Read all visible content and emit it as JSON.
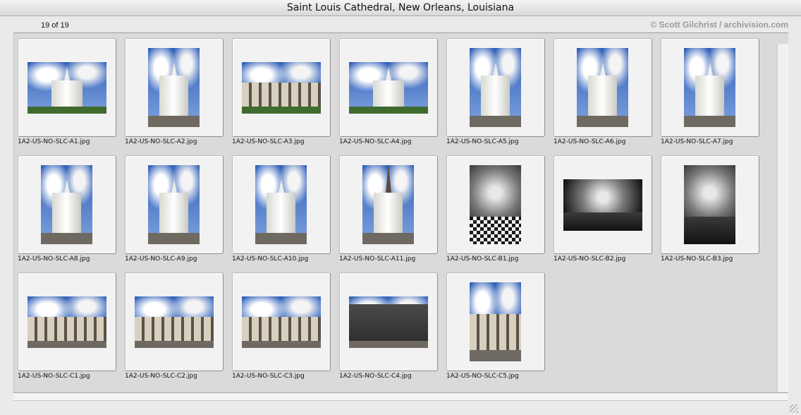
{
  "window": {
    "title": "Saint Louis Cathedral, New Orleans, Louisiana"
  },
  "toolbar": {
    "counter": "19 of 19",
    "credit": "© Scott Gilchrist / archivision.com"
  },
  "thumbnails": [
    {
      "filename": "1A2-US-NO-SLC-A1.jpg",
      "orientation": "landscape",
      "scene": "cathedral-blue-sky"
    },
    {
      "filename": "1A2-US-NO-SLC-A2.jpg",
      "orientation": "portrait",
      "scene": "cathedral-gate-lamps"
    },
    {
      "filename": "1A2-US-NO-SLC-A3.jpg",
      "orientation": "landscape",
      "scene": "jackson-square-statue"
    },
    {
      "filename": "1A2-US-NO-SLC-A4.jpg",
      "orientation": "landscape",
      "scene": "cathedral-square"
    },
    {
      "filename": "1A2-US-NO-SLC-A5.jpg",
      "orientation": "portrait",
      "scene": "cathedral-facade-fence"
    },
    {
      "filename": "1A2-US-NO-SLC-A6.jpg",
      "orientation": "portrait",
      "scene": "cathedral-side-street"
    },
    {
      "filename": "1A2-US-NO-SLC-A7.jpg",
      "orientation": "portrait",
      "scene": "cathedral-towers"
    },
    {
      "filename": "1A2-US-NO-SLC-A8.jpg",
      "orientation": "portrait",
      "scene": "cathedral-low-angle"
    },
    {
      "filename": "1A2-US-NO-SLC-A9.jpg",
      "orientation": "portrait",
      "scene": "cathedral-facade-detail"
    },
    {
      "filename": "1A2-US-NO-SLC-A10.jpg",
      "orientation": "portrait",
      "scene": "clock-tower"
    },
    {
      "filename": "1A2-US-NO-SLC-A11.jpg",
      "orientation": "portrait",
      "scene": "spire"
    },
    {
      "filename": "1A2-US-NO-SLC-B1.jpg",
      "orientation": "portrait",
      "scene": "interior-nave-bw"
    },
    {
      "filename": "1A2-US-NO-SLC-B2.jpg",
      "orientation": "landscape",
      "scene": "interior-ceiling-bw"
    },
    {
      "filename": "1A2-US-NO-SLC-B3.jpg",
      "orientation": "portrait",
      "scene": "interior-vault-bw"
    },
    {
      "filename": "1A2-US-NO-SLC-C1.jpg",
      "orientation": "landscape",
      "scene": "street-buildings"
    },
    {
      "filename": "1A2-US-NO-SLC-C2.jpg",
      "orientation": "landscape",
      "scene": "cabildo-arcade"
    },
    {
      "filename": "1A2-US-NO-SLC-C3.jpg",
      "orientation": "landscape",
      "scene": "cupola-roofline"
    },
    {
      "filename": "1A2-US-NO-SLC-C4.jpg",
      "orientation": "landscape",
      "scene": "dormer-windows"
    },
    {
      "filename": "1A2-US-NO-SLC-C5.jpg",
      "orientation": "portrait",
      "scene": "cupola-tower"
    }
  ],
  "colors": {
    "sky": "#3d6fc4",
    "bw": "#2a2a2a"
  }
}
